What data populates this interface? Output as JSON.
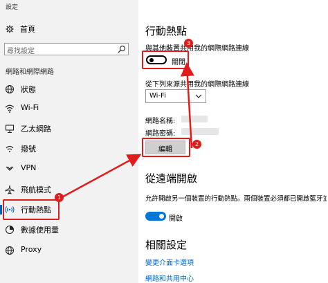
{
  "window": {
    "title": "設定"
  },
  "sidebar": {
    "home": "首頁",
    "search_placeholder": "尋找設定",
    "section": "網路和網際網路",
    "items": [
      {
        "label": "狀態",
        "icon": "globe-icon"
      },
      {
        "label": "Wi-Fi",
        "icon": "wifi-icon"
      },
      {
        "label": "乙太網路",
        "icon": "ethernet-icon"
      },
      {
        "label": "撥號",
        "icon": "dialup-icon"
      },
      {
        "label": "VPN",
        "icon": "vpn-icon"
      },
      {
        "label": "飛航模式",
        "icon": "airplane-icon"
      },
      {
        "label": "行動熱點",
        "icon": "hotspot-icon",
        "active": true
      },
      {
        "label": "數據使用量",
        "icon": "data-usage-icon"
      },
      {
        "label": "Proxy",
        "icon": "globe-icon"
      }
    ]
  },
  "main": {
    "title": "行動熱點",
    "share_label": "與其他裝置共用我的網際網路連線",
    "share_toggle": {
      "state": "關閉",
      "on": false
    },
    "source_label": "從下列來源共用我的網際網路連線",
    "source_value": "Wi-Fi",
    "network_name_label": "網路名稱:",
    "network_password_label": "網路密碼:",
    "edit_button": "編輯",
    "remote_title": "從遠端開啟",
    "remote_desc": "允許開啟另一個裝置的行動熱點。兩個裝置必須都已開啟藍牙並配",
    "remote_toggle": {
      "state": "開啟",
      "on": true
    },
    "related_title": "相關設定",
    "links": [
      "變更介面卡選項",
      "網路和共用中心"
    ]
  },
  "annotations": {
    "badges": [
      "1",
      "2",
      "3"
    ],
    "color": "#e11c1c"
  },
  "accent": "#0078d7"
}
